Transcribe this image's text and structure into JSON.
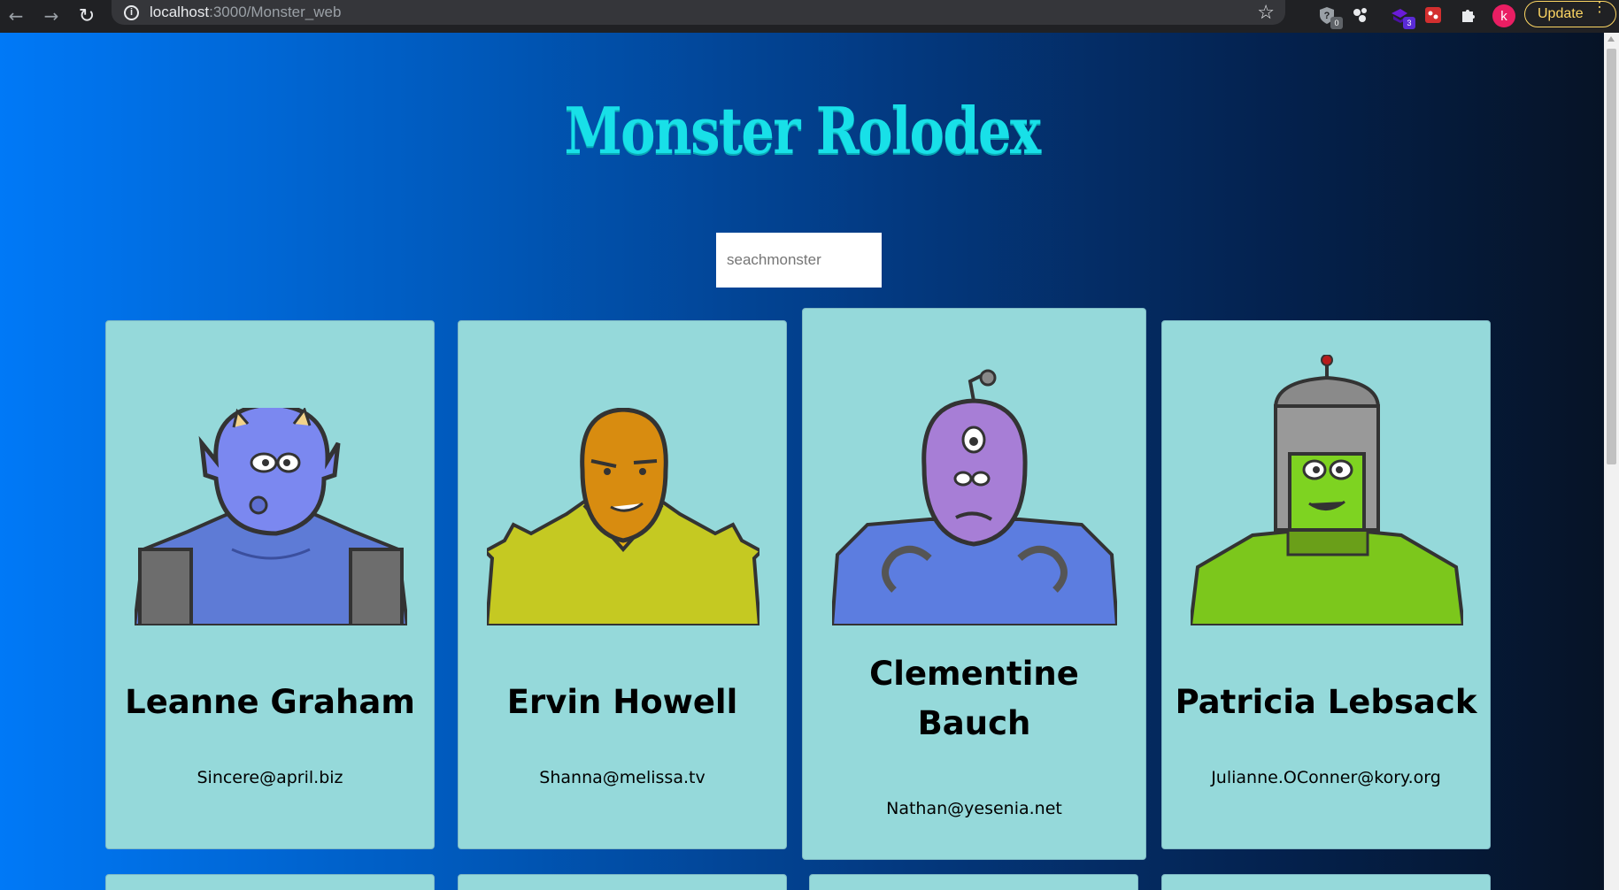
{
  "browser": {
    "url_host": "localhost",
    "url_path": ":3000/Monster_web",
    "ext_badge_1": "0",
    "ext_badge_2": "3",
    "avatar_letter": "k",
    "update_label": "Update"
  },
  "page": {
    "title": "Monster Rolodex",
    "search_placeholder": "seachmonster"
  },
  "monsters": [
    {
      "name": "Leanne Graham",
      "email": "Sincere@april.biz",
      "color": "#6f86e8"
    },
    {
      "name": "Ervin Howell",
      "email": "Shanna@melissa.tv",
      "color": "#cf8a13"
    },
    {
      "name_line1": "Clementine",
      "name_line2": "Bauch",
      "email": "Nathan@yesenia.net",
      "color": "#a27ad8"
    },
    {
      "name": "Patricia Lebsack",
      "email": "Julianne.OConner@kory.org",
      "color": "#7ed321"
    }
  ]
}
